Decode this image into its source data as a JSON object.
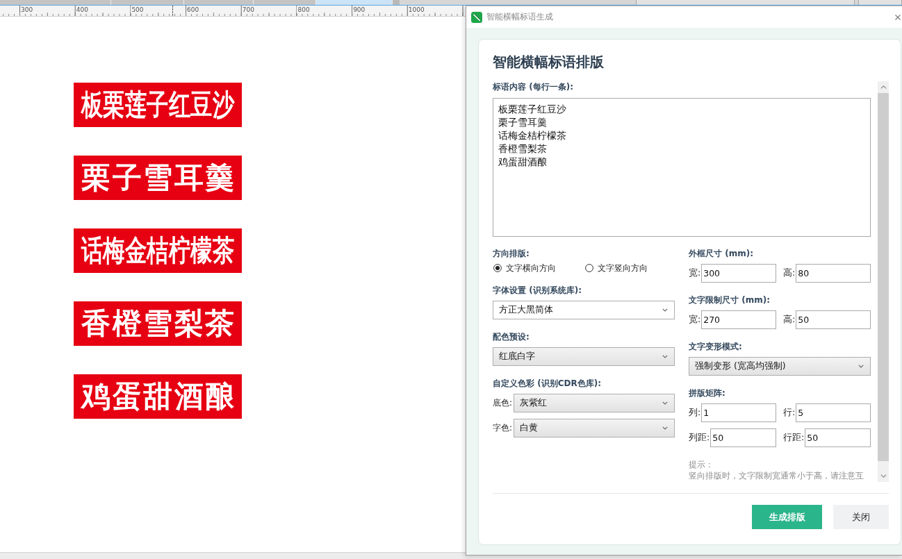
{
  "tab_strip": {
    "tabs": [
      {
        "selected": false
      },
      {
        "selected": false
      },
      {
        "selected": false
      },
      {
        "selected": false
      },
      {
        "selected": true
      }
    ]
  },
  "ruler": {
    "labels": [
      "300",
      "400",
      "500",
      "600",
      "700",
      "800",
      "900",
      "1000"
    ]
  },
  "canvas": {
    "banners": [
      {
        "text": "板栗莲子红豆沙"
      },
      {
        "text": "栗子雪耳羹"
      },
      {
        "text": "话梅金桔柠檬茶"
      },
      {
        "text": "香橙雪梨茶"
      },
      {
        "text": "鸡蛋甜酒酿"
      }
    ]
  },
  "dialog": {
    "title": "智能横幅标语生成",
    "heading": "智能横幅标语排版",
    "slogan_content": {
      "label": "标语内容 (每行一条):",
      "lines": [
        "板栗莲子红豆沙",
        "栗子雪耳羹",
        "话梅金桔柠檬茶",
        "香橙雪梨茶",
        "鸡蛋甜酒酿"
      ]
    },
    "direction": {
      "label": "方向排版:",
      "options": [
        {
          "label": "文字横向方向",
          "selected": true
        },
        {
          "label": "文字竖向方向",
          "selected": false
        }
      ]
    },
    "font": {
      "label": "字体设置 (识别系统库):",
      "value": "方正大黑简体"
    },
    "color_preset": {
      "label": "配色预设:",
      "value": "红底白字"
    },
    "custom_colors": {
      "label": "自定义色彩 (识别CDR色库):",
      "rows": [
        {
          "label": "底色:",
          "value": "灰紫红"
        },
        {
          "label": "字色:",
          "value": "白黄"
        }
      ]
    },
    "frame_size": {
      "label": "外框尺寸 (mm):",
      "fields": [
        {
          "label": "宽:",
          "value": "300"
        },
        {
          "label": "高:",
          "value": "80"
        }
      ]
    },
    "text_limit": {
      "label": "文字限制尺寸 (mm):",
      "fields": [
        {
          "label": "宽:",
          "value": "270"
        },
        {
          "label": "高:",
          "value": "50"
        }
      ]
    },
    "deform_mode": {
      "label": "文字变形模式:",
      "value": "强制变形 (宽高均强制)"
    },
    "imposition": {
      "label": "拼版矩阵:",
      "fields": [
        {
          "label": "列:",
          "value": "1"
        },
        {
          "label": "行:",
          "value": "5"
        },
        {
          "label": "列距:",
          "value": "50"
        },
        {
          "label": "行距:",
          "value": "50"
        }
      ]
    },
    "hint": {
      "title": "提示：",
      "text": "竖向排版时，文字限制宽通常小于高，请注意互"
    },
    "buttons": [
      {
        "label": "生成排版",
        "kind": "primary"
      },
      {
        "label": "关闭",
        "kind": "secondary"
      }
    ]
  }
}
